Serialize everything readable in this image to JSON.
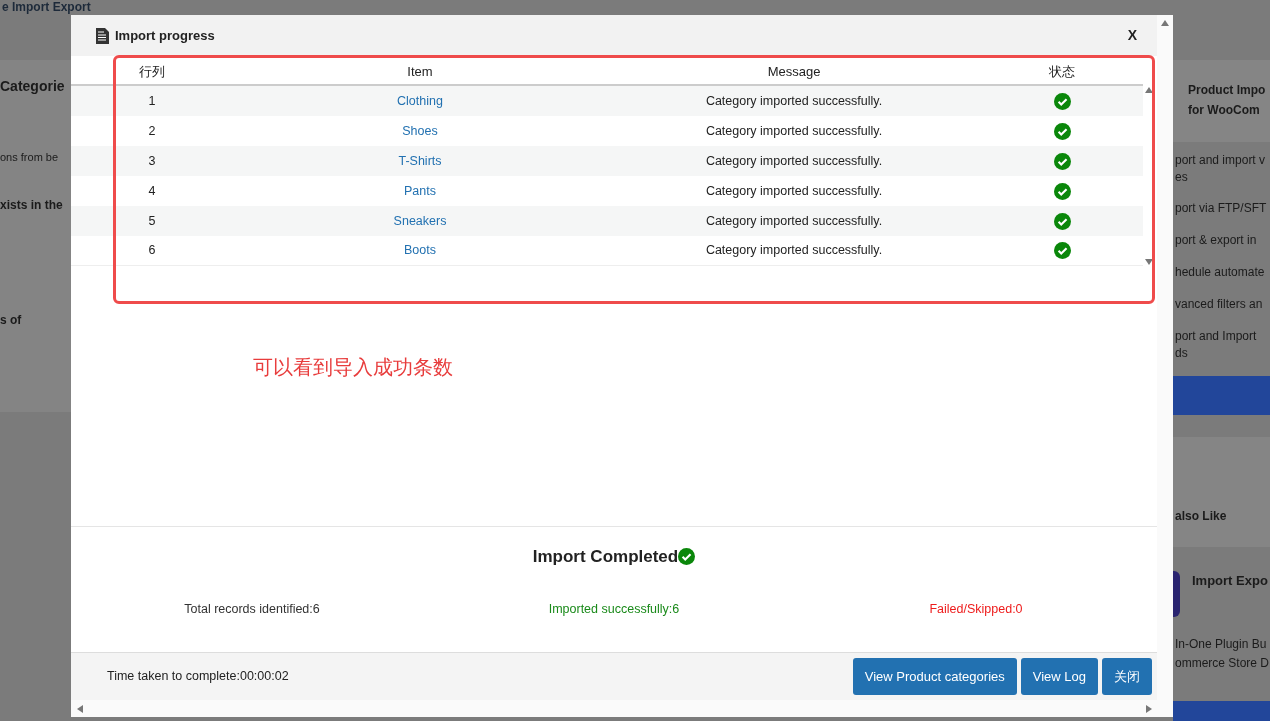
{
  "background": {
    "title": "e Import Export",
    "left_texts": [
      {
        "text": "Categorie",
        "kind": "heading"
      },
      {
        "text": "ons from be",
        "kind": "plain"
      },
      {
        "text": "xists in the",
        "kind": "bold"
      },
      {
        "text": "s of",
        "kind": "bold"
      }
    ],
    "right_heading": [
      "Product Impo",
      "for WooCom"
    ],
    "right_items": [
      "port and import v\nes",
      "port via FTP/SFT",
      "port & export in",
      "hedule automate",
      "vanced filters an",
      "port and Import\nds"
    ],
    "right_section": "also Like",
    "right_card_title": "Import Expo",
    "right_card_text": [
      "In-One Plugin Bu",
      "ommerce Store D"
    ]
  },
  "modal": {
    "title": "Import progress",
    "close": "X",
    "table": {
      "columns": [
        "行列",
        "Item",
        "Message",
        "状态"
      ],
      "rows": [
        {
          "row": "1",
          "item": "Clothing",
          "message": "Category imported successfully.",
          "success": true
        },
        {
          "row": "2",
          "item": "Shoes",
          "message": "Category imported successfully.",
          "success": true
        },
        {
          "row": "3",
          "item": "T-Shirts",
          "message": "Category imported successfully.",
          "success": true
        },
        {
          "row": "4",
          "item": "Pants",
          "message": "Category imported successfully.",
          "success": true
        },
        {
          "row": "5",
          "item": "Sneakers",
          "message": "Category imported successfully.",
          "success": true
        },
        {
          "row": "6",
          "item": "Boots",
          "message": "Category imported successfully.",
          "success": true
        }
      ]
    },
    "summary": {
      "heading": "Import Completed",
      "total": "Total records identified:6",
      "imported": "Imported successfully:6",
      "failed": "Failed/Skipped:0"
    },
    "footer": {
      "time": "Time taken to complete:00:00:02",
      "buttons": [
        "View Product categories",
        "View Log",
        "关闭"
      ]
    }
  },
  "annotation": {
    "text": "可以看到导入成功条数"
  }
}
